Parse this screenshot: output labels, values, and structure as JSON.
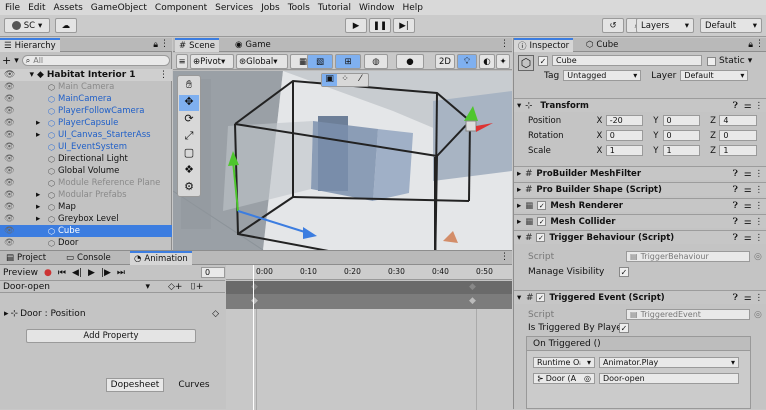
{
  "menu": [
    "File",
    "Edit",
    "Assets",
    "GameObject",
    "Component",
    "Services",
    "Jobs",
    "Tools",
    "Tutorial",
    "Window",
    "Help"
  ],
  "toolbar": {
    "account": "SC",
    "layers": "Layers",
    "layout": "Default"
  },
  "hierarchy": {
    "tab": "Hierarchy",
    "search_placeholder": "All",
    "scene": "Habitat Interior 1",
    "items": [
      {
        "label": "Main Camera",
        "style": "dim",
        "indent": 2
      },
      {
        "label": "MainCamera",
        "style": "blue",
        "indent": 2
      },
      {
        "label": "PlayerFollowCamera",
        "style": "blue",
        "indent": 2
      },
      {
        "label": "PlayerCapsule",
        "style": "blue",
        "indent": 2,
        "arrow": true
      },
      {
        "label": "UI_Canvas_StarterAss",
        "style": "blue",
        "indent": 2,
        "arrow": true
      },
      {
        "label": "UI_EventSystem",
        "style": "blue",
        "indent": 2
      },
      {
        "label": "Directional Light",
        "style": "normal",
        "indent": 2
      },
      {
        "label": "Global Volume",
        "style": "normal",
        "indent": 2
      },
      {
        "label": "Module Reference Plane",
        "style": "dim",
        "indent": 2
      },
      {
        "label": "Modular Prefabs",
        "style": "dim",
        "indent": 2,
        "arrow": true
      },
      {
        "label": "Map",
        "style": "normal",
        "indent": 2,
        "arrow": true
      },
      {
        "label": "Greybox Level",
        "style": "normal",
        "indent": 2,
        "arrow": true
      },
      {
        "label": "Cube",
        "style": "selected",
        "indent": 2
      },
      {
        "label": "Door",
        "style": "normal",
        "indent": 2
      }
    ]
  },
  "scene_view": {
    "tabs": [
      {
        "label": "Scene"
      },
      {
        "label": "Game"
      }
    ],
    "pivot": "Pivot",
    "global": "Global",
    "mode_2d": "2D"
  },
  "bottom_panel": {
    "tabs": [
      {
        "label": "Project"
      },
      {
        "label": "Console"
      },
      {
        "label": "Animation"
      }
    ],
    "preview": "Preview",
    "frame": "0",
    "clip": "Door-open",
    "timeline": [
      "0:00",
      "0:10",
      "0:20",
      "0:30",
      "0:40",
      "0:50"
    ],
    "property": "Door : Position",
    "add_property": "Add Property",
    "dopesheet": "Dopesheet",
    "curves": "Curves"
  },
  "inspector": {
    "tabs": [
      {
        "label": "Inspector"
      },
      {
        "label": "Cube"
      }
    ],
    "name": "Cube",
    "static": "Static",
    "tag_label": "Tag",
    "tag": "Untagged",
    "layer_label": "Layer",
    "layer": "Default",
    "transform": {
      "title": "Transform",
      "rows": [
        {
          "label": "Position",
          "x": "-20",
          "y": "0",
          "z": "4"
        },
        {
          "label": "Rotation",
          "x": "0",
          "y": "0",
          "z": "0"
        },
        {
          "label": "Scale",
          "x": "1",
          "y": "1",
          "z": "1"
        }
      ]
    },
    "components": [
      "ProBuilder MeshFilter",
      "Pro Builder Shape (Script)",
      "Mesh Renderer",
      "Mesh Collider",
      "Trigger Behaviour (Script)"
    ],
    "trigger": {
      "script_label": "Script",
      "script": "TriggerBehaviour",
      "manage_label": "Manage Visibility"
    },
    "event": {
      "title": "Triggered Event (Script)",
      "script_label": "Script",
      "script": "TriggeredEvent",
      "is_triggered": "Is Triggered By Playe",
      "on_triggered": "On Triggered ()",
      "runtime": "Runtime Oᵢ",
      "function": "Animator.Play",
      "object": "Door (A",
      "param": "Door-open"
    }
  }
}
